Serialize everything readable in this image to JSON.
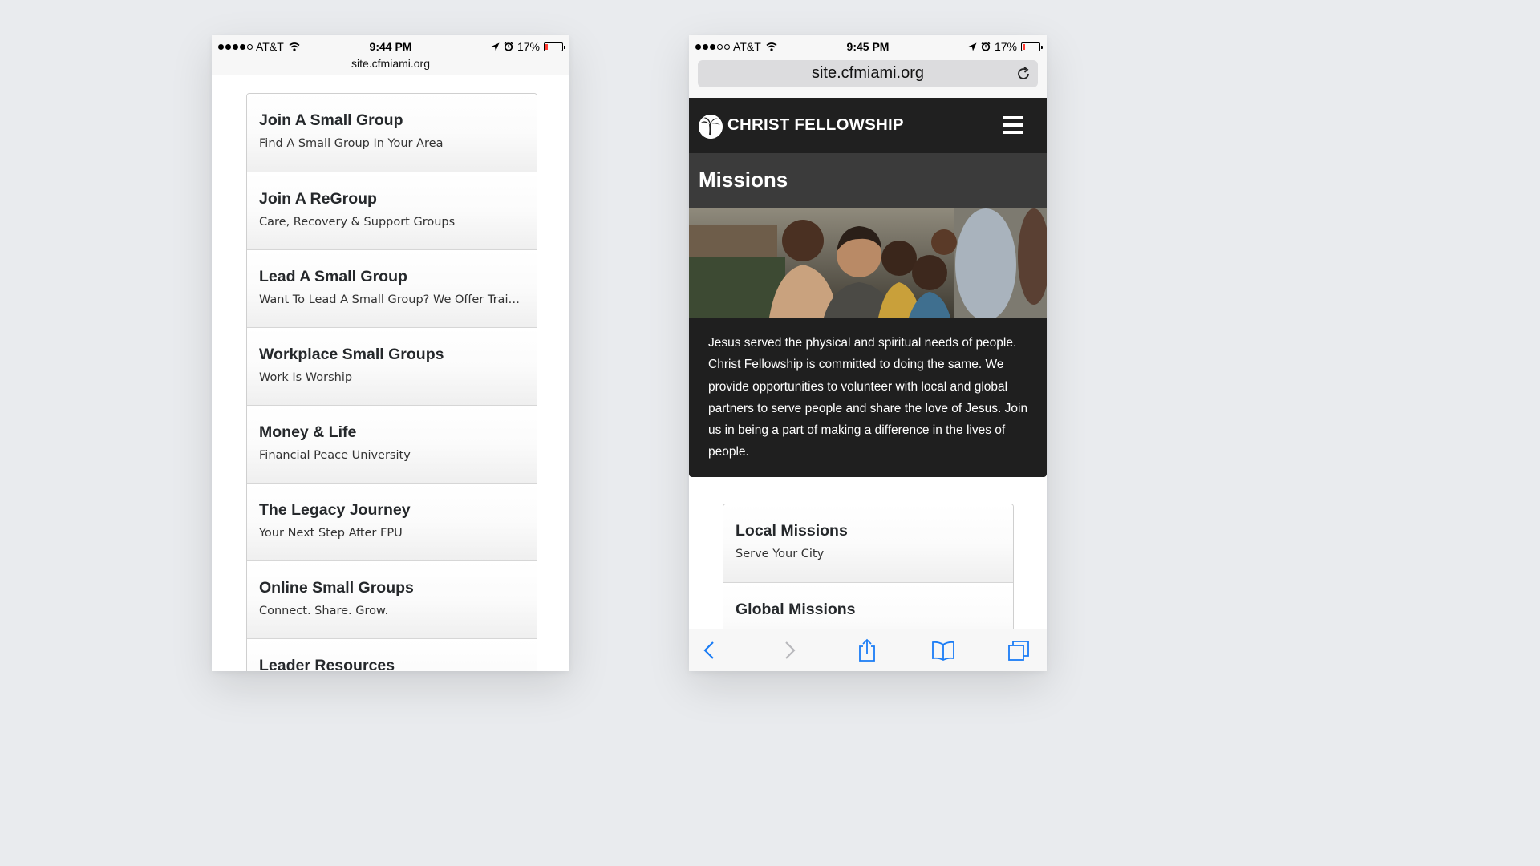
{
  "left_phone": {
    "status": {
      "carrier": "AT&T",
      "time": "9:44 PM",
      "battery": "17%",
      "battery_level": 0.17
    },
    "url": "site.cfmiami.org",
    "cards": [
      {
        "title": "Join A Small Group",
        "subtitle": "Find A Small Group In Your Area"
      },
      {
        "title": "Join A ReGroup",
        "subtitle": "Care, Recovery & Support Groups"
      },
      {
        "title": "Lead A Small Group",
        "subtitle": "Want To Lead A Small Group? We Offer Traini…"
      },
      {
        "title": "Workplace Small Groups",
        "subtitle": "Work Is Worship"
      },
      {
        "title": "Money & Life",
        "subtitle": "Financial Peace University"
      },
      {
        "title": "The Legacy Journey",
        "subtitle": "Your Next Step After FPU"
      },
      {
        "title": "Online Small Groups",
        "subtitle": "Connect. Share. Grow."
      },
      {
        "title": "Leader Resources",
        "subtitle": ""
      }
    ]
  },
  "right_phone": {
    "status": {
      "carrier": "AT&T",
      "time": "9:45 PM",
      "battery": "17%",
      "battery_level": 0.17
    },
    "url": "site.cfmiami.org",
    "brand": "CHRIST FELLOWSHIP",
    "page_title": "Missions",
    "description": "Jesus served the physical and spiritual needs of people. Christ Fellowship is committed to doing the same. We provide opportunities to volunteer with local and global partners to serve people and share the love of Jesus. Join us in being a part of making a difference in the lives of people.",
    "cards": [
      {
        "title": "Local Missions",
        "subtitle": "Serve Your City"
      },
      {
        "title": "Global Missions",
        "subtitle": ""
      }
    ],
    "toolbar_icons": [
      "back-icon",
      "forward-icon",
      "share-icon",
      "bookmarks-icon",
      "tabs-icon"
    ]
  },
  "colors": {
    "background": "#e9ebee",
    "header_dark": "#202020",
    "title_bar": "#3b3b3b",
    "safari_blue": "#1a7cf5",
    "battery_red": "#ff3b30"
  }
}
